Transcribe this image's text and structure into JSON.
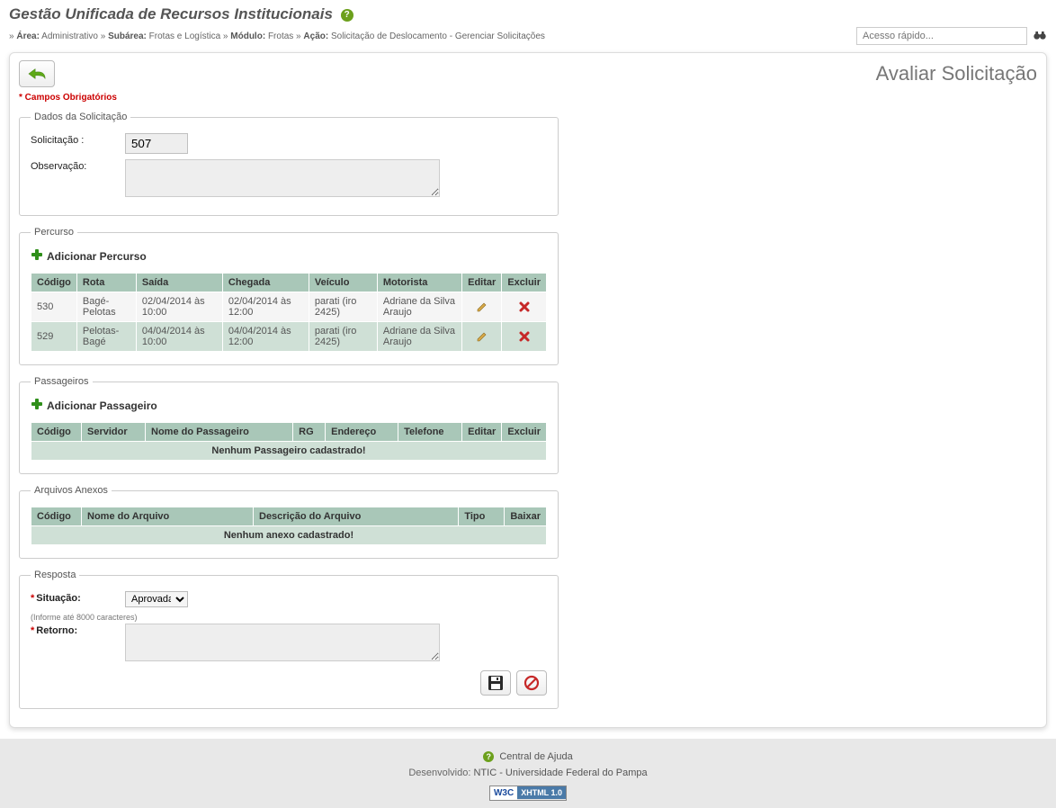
{
  "system_title": "Gestão Unificada de Recursos Institucionais",
  "breadcrumb": {
    "area_label": "Área:",
    "area_value": "Administrativo",
    "subarea_label": "Subárea:",
    "subarea_value": "Frotas e Logística",
    "modulo_label": "Módulo:",
    "modulo_value": "Frotas",
    "acao_label": "Ação:",
    "acao_value": "Solicitação de Deslocamento - Gerenciar Solicitações"
  },
  "quick_access": {
    "placeholder": "Acesso rápido..."
  },
  "page_title": "Avaliar Solicitação",
  "required_note": "* Campos Obrigatórios",
  "dados_solicitacao": {
    "legend": "Dados da Solicitação",
    "solicitacao_label": "Solicitação :",
    "solicitacao_value": "507",
    "observacao_label": "Observação:",
    "observacao_value": ""
  },
  "percurso": {
    "legend": "Percurso",
    "add_label": "Adicionar Percurso",
    "headers": [
      "Código",
      "Rota",
      "Saída",
      "Chegada",
      "Veículo",
      "Motorista",
      "Editar",
      "Excluir"
    ],
    "rows": [
      {
        "codigo": "530",
        "rota": "Bagé-Pelotas",
        "saida": "02/04/2014 às 10:00",
        "chegada": "02/04/2014 às 12:00",
        "veiculo": "parati (iro 2425)",
        "motorista": "Adriane da Silva Araujo"
      },
      {
        "codigo": "529",
        "rota": "Pelotas-Bagé",
        "saida": "04/04/2014 às 10:00",
        "chegada": "04/04/2014 às 12:00",
        "veiculo": "parati (iro 2425)",
        "motorista": "Adriane da Silva Araujo"
      }
    ]
  },
  "passageiros": {
    "legend": "Passageiros",
    "add_label": "Adicionar Passageiro",
    "headers": [
      "Código",
      "Servidor",
      "Nome do Passageiro",
      "RG",
      "Endereço",
      "Telefone",
      "Editar",
      "Excluir"
    ],
    "empty_message": "Nenhum Passageiro cadastrado!"
  },
  "arquivos": {
    "legend": "Arquivos Anexos",
    "headers": [
      "Código",
      "Nome do Arquivo",
      "Descrição do Arquivo",
      "Tipo",
      "Baixar"
    ],
    "empty_message": "Nenhum anexo cadastrado!"
  },
  "resposta": {
    "legend": "Resposta",
    "situacao_label": "Situação:",
    "situacao_value": "Aprovada",
    "situacao_options": [
      "Aprovada"
    ],
    "char_note": "(Informe até 8000 caracteres)",
    "retorno_label": "Retorno:",
    "retorno_value": ""
  },
  "footer": {
    "help_link": "Central de Ajuda",
    "developed_label": "Desenvolvido:",
    "developed_value": "NTIC - Universidade Federal do Pampa",
    "w3c_left": "W3C",
    "w3c_right": "XHTML 1.0"
  }
}
